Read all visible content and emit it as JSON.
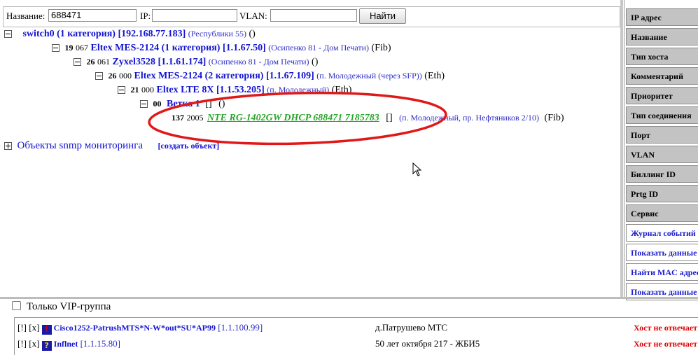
{
  "search": {
    "name_label": "Название:",
    "name_value": "688471",
    "ip_label": "IP:",
    "ip_value": "",
    "vlan_label": "VLAN:",
    "vlan_value": "",
    "submit_label": "Найти"
  },
  "tree": {
    "switch0": {
      "title": "switch0 (1 категория)",
      "ip": "[192.168.77.183]",
      "addr": "(Республики 55)",
      "extra": "()"
    },
    "n1": {
      "num": "19",
      "code": "067",
      "title": "Eltex MES-2124 (1 категория)",
      "ip": "[1.1.67.50]",
      "addr": "(Осипенко 81 - Дом Печати)",
      "extra": "(Fib)"
    },
    "n2": {
      "num": "26",
      "code": "061",
      "title": "Zyxel3528",
      "ip": "[1.1.61.174]",
      "addr": "(Осипенко 81 - Дом Печати)",
      "extra": "()"
    },
    "n3": {
      "num": "26",
      "code": "000",
      "title": "Eltex MES-2124 (2 категория)",
      "ip": "[1.1.67.109]",
      "addr": "(п. Молодежный (через SFP))",
      "extra": "(Eth)"
    },
    "n4": {
      "num": "21",
      "code": "000",
      "title": "Eltex LTE 8X",
      "ip": "[1.1.53.205]",
      "addr": "(п. Молодежный)",
      "extra": "(Eth)"
    },
    "n5": {
      "num": "00",
      "title": "Ветка 1",
      "ip": "[]",
      "extra": "()"
    },
    "n6": {
      "num": "137",
      "code": "2005",
      "title": "NTE RG-1402GW DHCP 688471 7185783",
      "ip": "[]",
      "addr": "(п. Молодежный, пр. Нефтяников 2/10)",
      "extra": "(Fib)"
    },
    "snmp": {
      "title": "Объекты snmp мониторинга",
      "create": "[создать объект]"
    }
  },
  "panel": {
    "buttons": [
      "IP адрес",
      "Название",
      "Тип хоста",
      "Комментарий",
      "Приоритет",
      "Тип соединения",
      "Порт",
      "VLAN",
      "Биллинг ID",
      "Prtg ID",
      "Сервис"
    ],
    "links": [
      "Журнал событий",
      "Показать данные",
      "Найти MAC адрес",
      "Показать данные"
    ]
  },
  "vip": {
    "label": "Только VIP-группа"
  },
  "list": [
    {
      "ctl1": "[!]",
      "ctl2": "[x]",
      "icon": "error-icon",
      "name": "Cisco1252-PatrushMTS*N-W*out*SU*AP99",
      "ip": "[1.1.100.99]",
      "location": "д.Патрушево МТС",
      "status": "Хост не отвечает"
    },
    {
      "ctl1": "[!]",
      "ctl2": "[x]",
      "icon": "question-icon",
      "name": "Inflnet",
      "ip": "[1.1.15.80]",
      "location": "50 лет октября 217 - ЖБИ5",
      "status": "Хост не отвечает"
    }
  ],
  "colors": {
    "highlight_ellipse": "#e01818",
    "link_blue": "#1414d2",
    "status_red": "#e00000",
    "green_link": "#2aa62a"
  }
}
